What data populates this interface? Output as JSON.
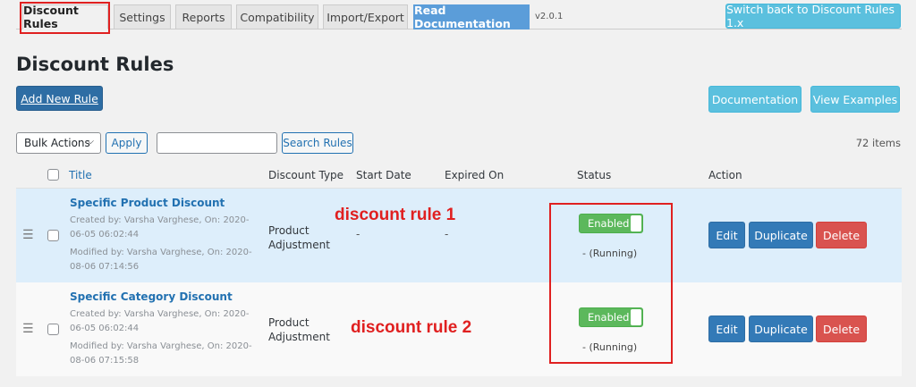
{
  "tabs": [
    {
      "label": "Discount Rules"
    },
    {
      "label": "Settings"
    },
    {
      "label": "Reports"
    },
    {
      "label": "Compatibility"
    },
    {
      "label": "Import/Export"
    },
    {
      "label": "Read Documentation"
    }
  ],
  "version": "v2.0.1",
  "switch_back_label": "Switch back to Discount Rules 1.x",
  "page_title": "Discount Rules",
  "add_new_label": "Add New Rule",
  "documentation_label": "Documentation",
  "view_examples_label": "View Examples",
  "bulk_actions": {
    "selected": "Bulk Actions",
    "apply_label": "Apply"
  },
  "search": {
    "value": "",
    "button_label": "Search Rules"
  },
  "items_count": "72 items",
  "columns": [
    "Title",
    "Discount Type",
    "Start Date",
    "Expired On",
    "Status",
    "Action"
  ],
  "rows": [
    {
      "title": "Specific Product Discount",
      "created": "Created by: Varsha Varghese, On: 2020-06-05 06:02:44",
      "modified": "Modified by: Varsha Varghese, On: 2020-08-06 07:14:56",
      "type_line1": "Product",
      "type_line2": "Adjustment",
      "start": "-",
      "expired": "-",
      "status": "Enabled",
      "running": "- (Running)",
      "edit": "Edit",
      "duplicate": "Duplicate",
      "delete": "Delete"
    },
    {
      "title": "Specific Category Discount",
      "created": "Created by: Varsha Varghese, On: 2020-06-05 06:02:44",
      "modified": "Modified by: Varsha Varghese, On: 2020-08-06 07:15:58",
      "type_line1": "Product",
      "type_line2": "Adjustment",
      "status": "Enabled",
      "running": "- (Running)",
      "edit": "Edit",
      "duplicate": "Duplicate",
      "delete": "Delete"
    }
  ],
  "annotations": {
    "rule1": "discount rule 1",
    "rule2": "discount rule 2"
  },
  "colors": {
    "primary": "#337ab7",
    "info": "#5bc0de",
    "success": "#5cb85c",
    "danger": "#d9534f",
    "highlight": "#e02020"
  }
}
